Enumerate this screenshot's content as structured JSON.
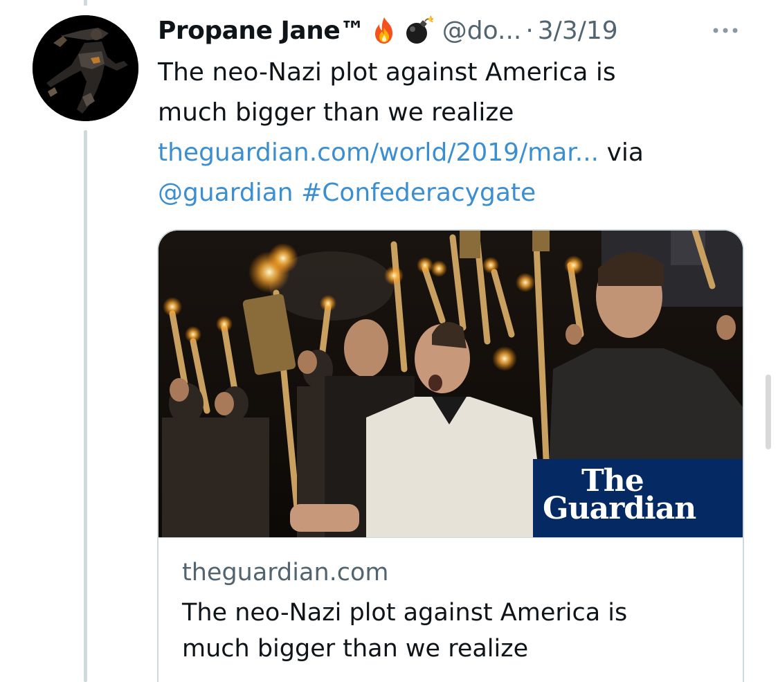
{
  "tweet": {
    "display_name": "Propane Jane™",
    "emojis": [
      "fire-icon",
      "bomb-icon"
    ],
    "handle": "@do...",
    "separator": "·",
    "date": "3/3/19",
    "more_icon": "more-horizontal-icon",
    "text": {
      "line1": "The neo-Nazi plot against America is",
      "line2": "much bigger than we realize",
      "link_url": "theguardian.com/world/2019/mar...",
      "via": "via",
      "mention": "@guardian",
      "hashtag": "#Confederacygate"
    }
  },
  "card": {
    "image_logo_line1": "The",
    "image_logo_line2": "Guardian",
    "domain": "theguardian.com",
    "title_line1": "The neo-Nazi plot against America is",
    "title_line2": "much bigger than we realize"
  },
  "colors": {
    "link": "#1d9bf0",
    "secondary_text": "#536471",
    "guardian_blue": "#052962",
    "thread_line": "#cfd9de"
  }
}
